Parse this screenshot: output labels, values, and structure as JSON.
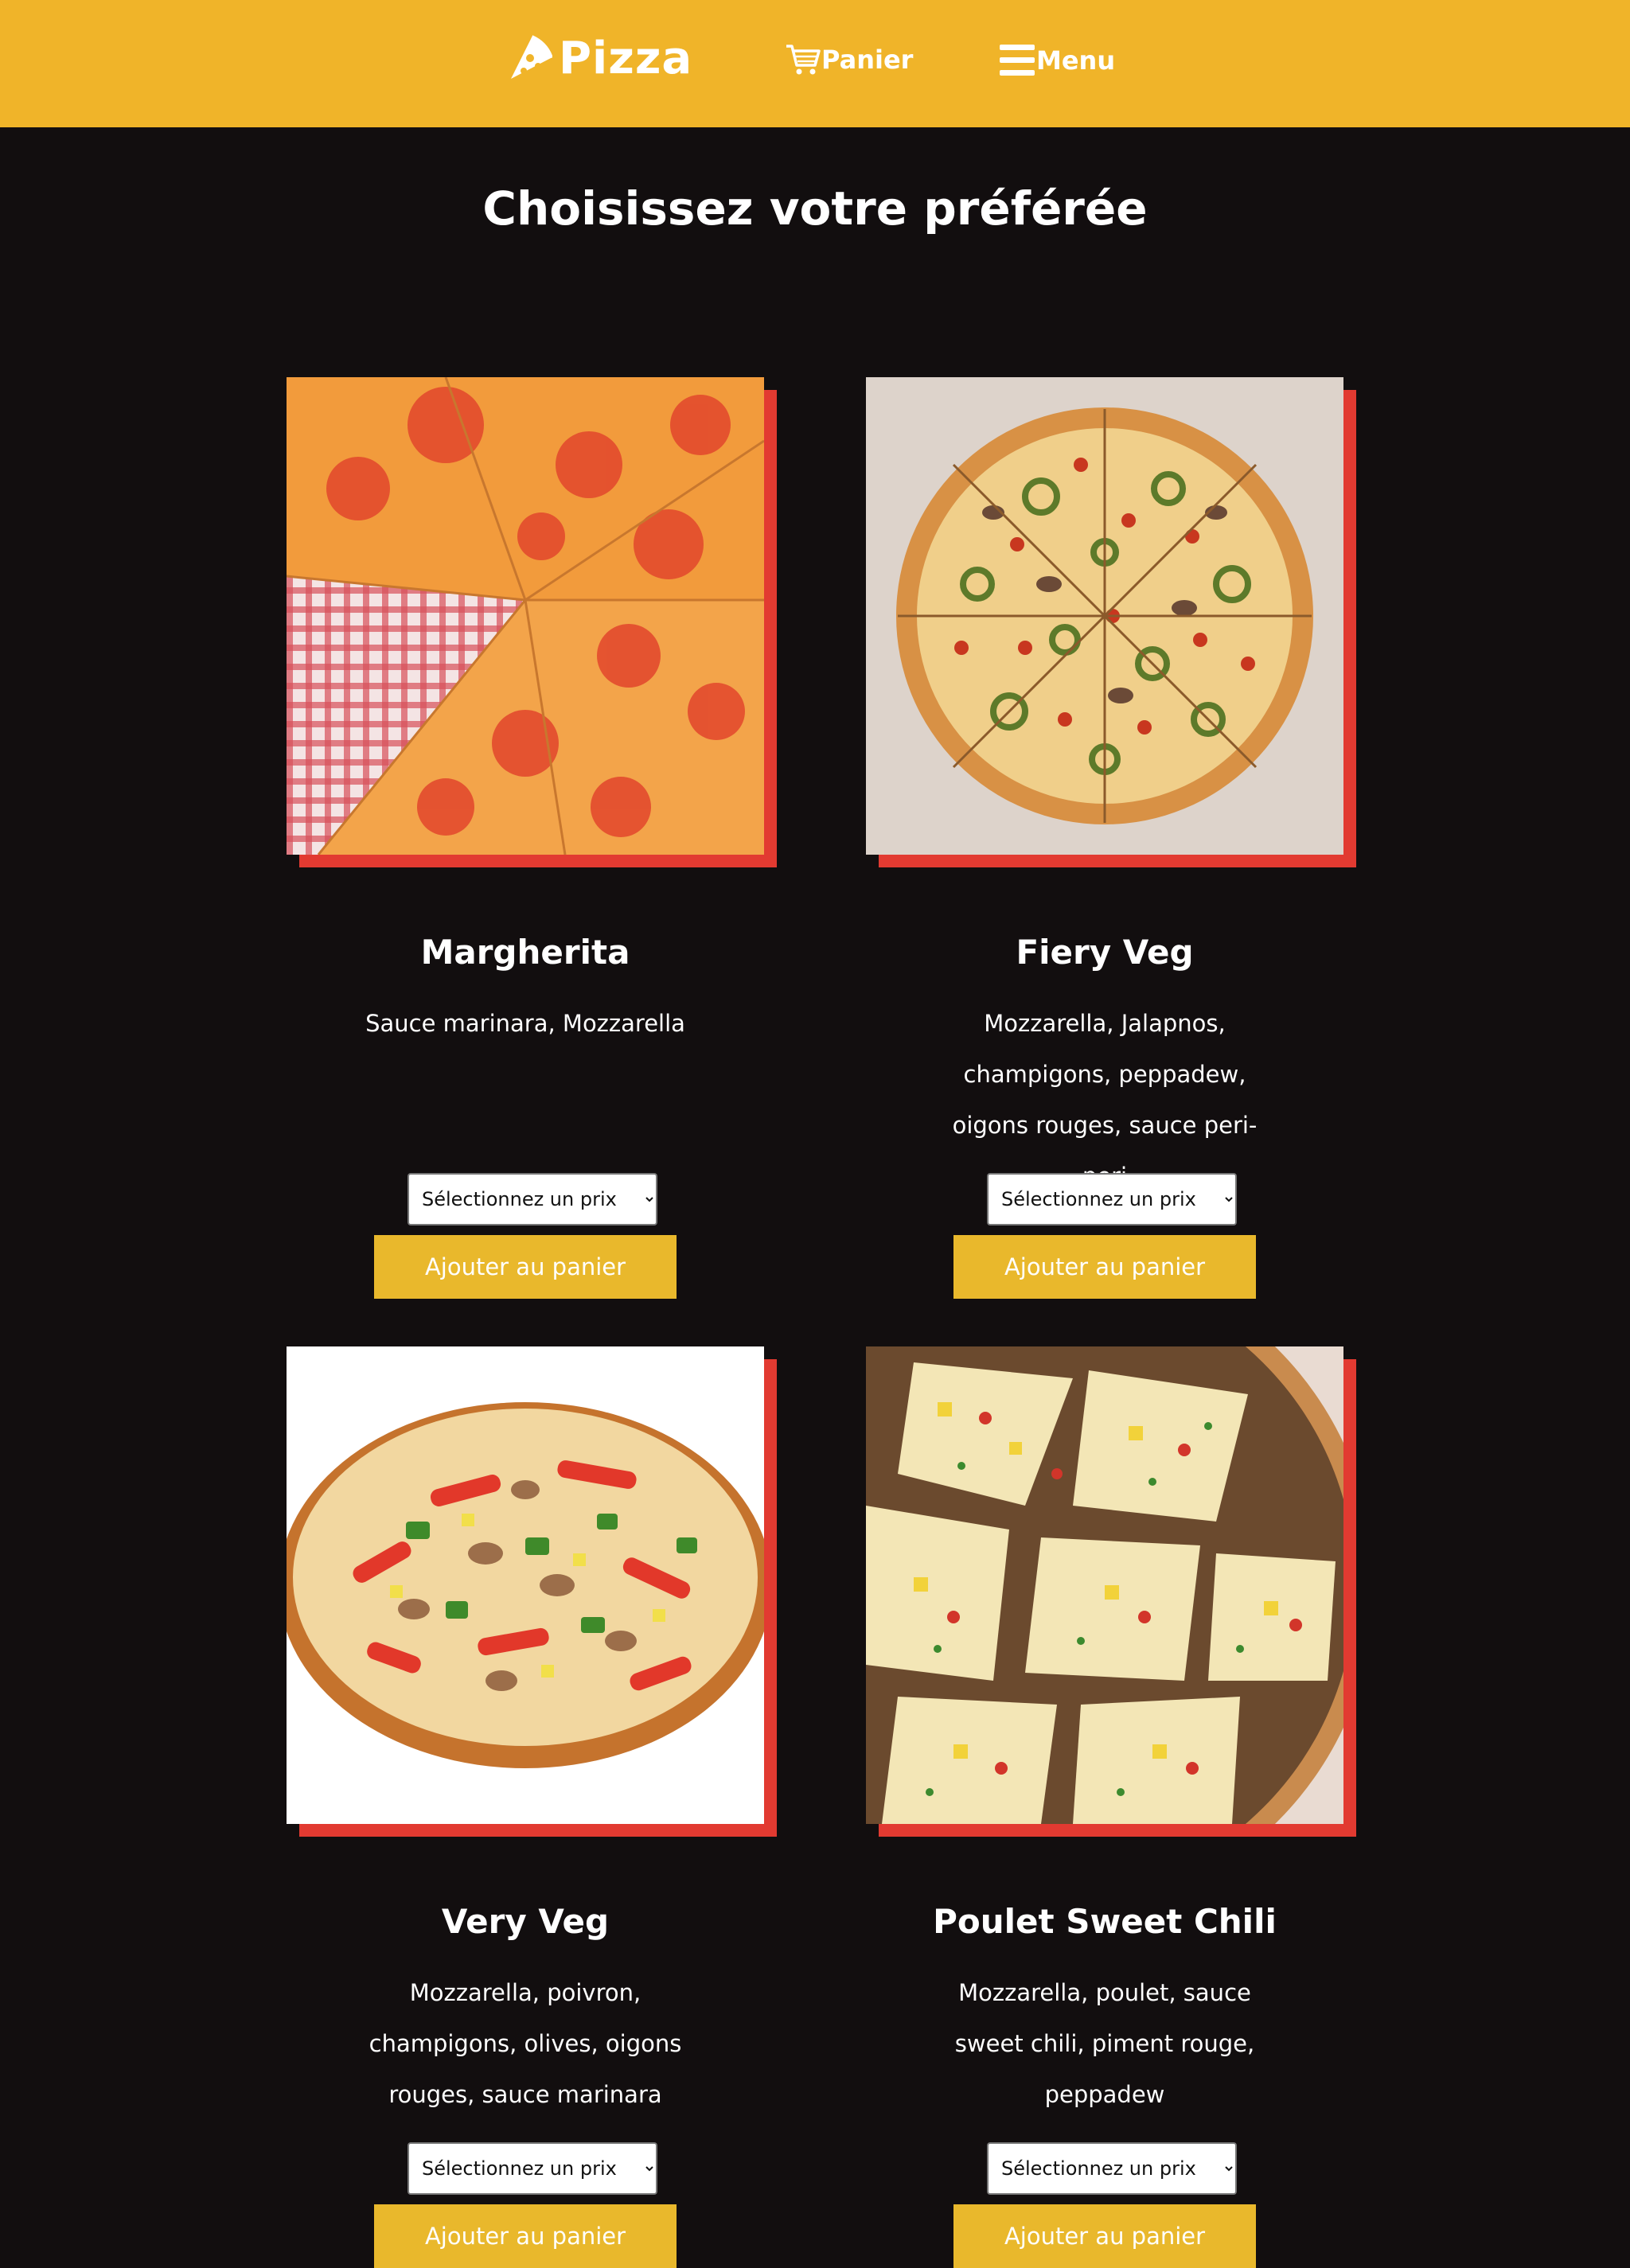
{
  "header": {
    "logo_text": "Pizza",
    "nav": {
      "cart_label": "Panier",
      "menu_label": "Menu"
    }
  },
  "main": {
    "title": "Choisissez votre préférée",
    "products": [
      {
        "name": "Margherita",
        "description": "Sauce marinara, Mozzarella",
        "price_placeholder": "Sélectionnez un prix",
        "add_label": "Ajouter au panier"
      },
      {
        "name": "Fiery Veg",
        "description": "Mozzarella, Jalapnos, champigons, peppadew, oigons rouges, sauce peri-peri",
        "price_placeholder": "Sélectionnez un prix",
        "add_label": "Ajouter au panier"
      },
      {
        "name": "Very Veg",
        "description": "Mozzarella, poivron, champigons, olives, oigons rouges, sauce marinara",
        "price_placeholder": "Sélectionnez un prix",
        "add_label": "Ajouter au panier"
      },
      {
        "name": "Poulet Sweet Chili",
        "description": "Mozzarella, poulet, sauce sweet chili, piment rouge, peppadew",
        "price_placeholder": "Sélectionnez un prix",
        "add_label": "Ajouter au panier"
      }
    ]
  },
  "colors": {
    "header_bg": "#f0b429",
    "page_bg": "#120e0f",
    "accent_red": "#e23a31",
    "button_bg": "#e9b82c"
  },
  "icons": {
    "logo": "pizza-slice-icon",
    "cart": "cart-icon",
    "menu": "hamburger-icon"
  }
}
